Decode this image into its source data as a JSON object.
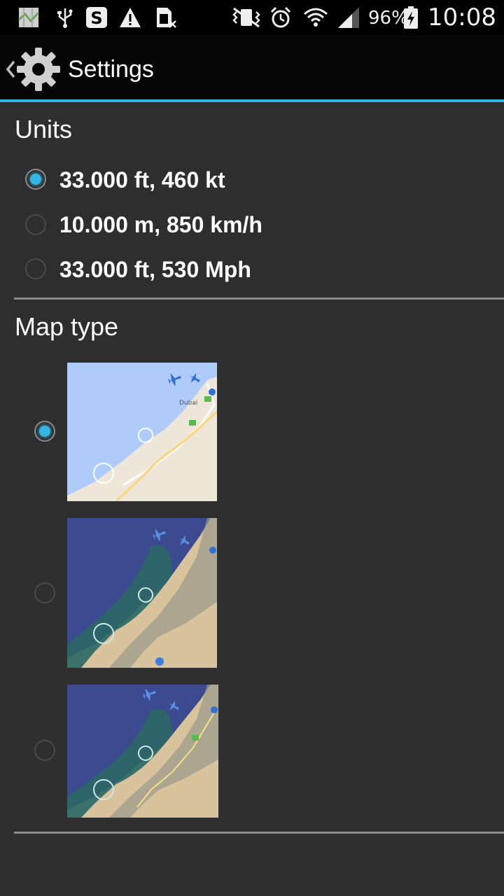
{
  "status_bar": {
    "battery": "96%",
    "time": "10:08",
    "icons": [
      "map-notification-icon",
      "usb-icon",
      "skype-icon",
      "warning-icon",
      "sim-icon",
      "mute-vibrate-icon",
      "alarm-icon",
      "wifi-icon",
      "signal-icon",
      "battery-charging-icon"
    ]
  },
  "action_bar": {
    "title": "Settings",
    "icon": "gear-icon"
  },
  "units": {
    "header": "Units",
    "options": [
      {
        "label": "33.000 ft, 460 kt",
        "selected": true
      },
      {
        "label": "10.000 m, 850 km/h",
        "selected": false
      },
      {
        "label": "33.000 ft, 530 Mph",
        "selected": false
      }
    ]
  },
  "map_type": {
    "header": "Map type",
    "options": [
      {
        "kind": "map",
        "selected": true,
        "city_label": "Dubai"
      },
      {
        "kind": "satellite",
        "selected": false
      },
      {
        "kind": "hybrid",
        "selected": false
      }
    ]
  },
  "colors": {
    "accent": "#33b5e5",
    "background": "#2e2e2e",
    "divider": "#8c8c8c"
  }
}
